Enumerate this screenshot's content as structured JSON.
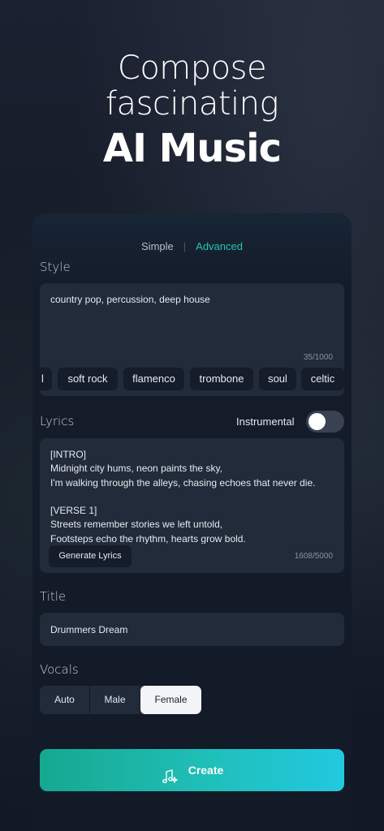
{
  "hero": {
    "line1": "Compose",
    "line2": "fascinating",
    "line3": "AI Music"
  },
  "mode": {
    "simple": "Simple",
    "separator": "|",
    "advanced": "Advanced",
    "active": "Advanced"
  },
  "style": {
    "label": "Style",
    "value": "country pop, percussion, deep house",
    "counter": "35/1000",
    "chips": [
      "l",
      "soft rock",
      "flamenco",
      "trombone",
      "soul",
      "celtic"
    ]
  },
  "lyrics": {
    "label": "Lyrics",
    "instrumental_label": "Instrumental",
    "instrumental_on": false,
    "lines": [
      "[INTRO]",
      "Midnight city hums, neon paints the sky,",
      "I'm walking through the alleys, chasing echoes that never die.",
      "",
      "[VERSE 1]",
      "Streets remember stories we left untold,",
      "Footsteps echo the rhythm, hearts grow bold."
    ],
    "generate_button": "Generate Lyrics",
    "counter": "1608/5000"
  },
  "title": {
    "label": "Title",
    "value": "Drummers Dream"
  },
  "vocals": {
    "label": "Vocals",
    "options": [
      "Auto",
      "Male",
      "Female"
    ],
    "selected": "Female"
  },
  "create_button": {
    "label": "Create",
    "icon": "music-sparkle-icon"
  },
  "colors": {
    "accent": "#26c3b0",
    "create_gradient_start": "#16a88f",
    "create_gradient_end": "#22c9df"
  }
}
